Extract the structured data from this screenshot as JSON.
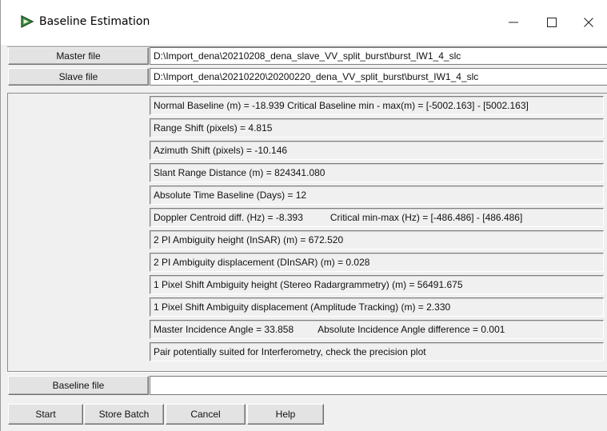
{
  "window": {
    "title": "Baseline Estimation",
    "minimize_glyph": "—",
    "maximize_glyph": "☐",
    "close_glyph": "✕"
  },
  "files": {
    "master_label": "Master file",
    "master_path": "D:\\Import_dena\\20210208_dena_slave_VV_split_burst\\burst_IW1_4_slc",
    "slave_label": "Slave file",
    "slave_path": "D:\\Import_dena\\20210220\\20200220_dena_VV_split_burst\\burst_IW1_4_slc"
  },
  "results": {
    "normal_baseline": "Normal Baseline (m) = -18.939 Critical Baseline min - max(m) = [-5002.163] - [5002.163]",
    "range_shift": "Range Shift (pixels)   = 4.815",
    "azimuth_shift": "Azimuth Shift (pixels)  = -10.146",
    "slant_range": "Slant Range Distance (m)  = 824341.080",
    "time_baseline": "Absolute Time Baseline (Days) = 12",
    "doppler_left": "Doppler Centroid diff. (Hz) = -8.393",
    "doppler_right": "Critical min-max (Hz) = [-486.486] - [486.486]",
    "ambiguity_height": "2 PI Ambiguity height (InSAR) (m) = 672.520",
    "ambiguity_displacement": "2 PI Ambiguity displacement (DInSAR) (m) = 0.028",
    "pixel_height": "1 Pixel Shift Ambiguity height (Stereo Radargrammetry) (m) = 56491.675",
    "pixel_displacement": "1 Pixel Shift Ambiguity displacement (Amplitude Tracking) (m) = 2.330",
    "incidence_left": "Master Incidence Angle = 33.858",
    "incidence_right": "Absolute Incidence Angle difference = 0.001",
    "suitability": "Pair potentially suited for Interferometry, check the precision plot"
  },
  "baseline_file": {
    "label": "Baseline file",
    "value": ""
  },
  "buttons": {
    "start": "Start",
    "store_batch": "Store Batch",
    "cancel": "Cancel",
    "help": "Help"
  },
  "colors": {
    "icon_green": "#3c8c3a",
    "icon_dark": "#1f4f2a",
    "face": "#f0f0f0"
  }
}
